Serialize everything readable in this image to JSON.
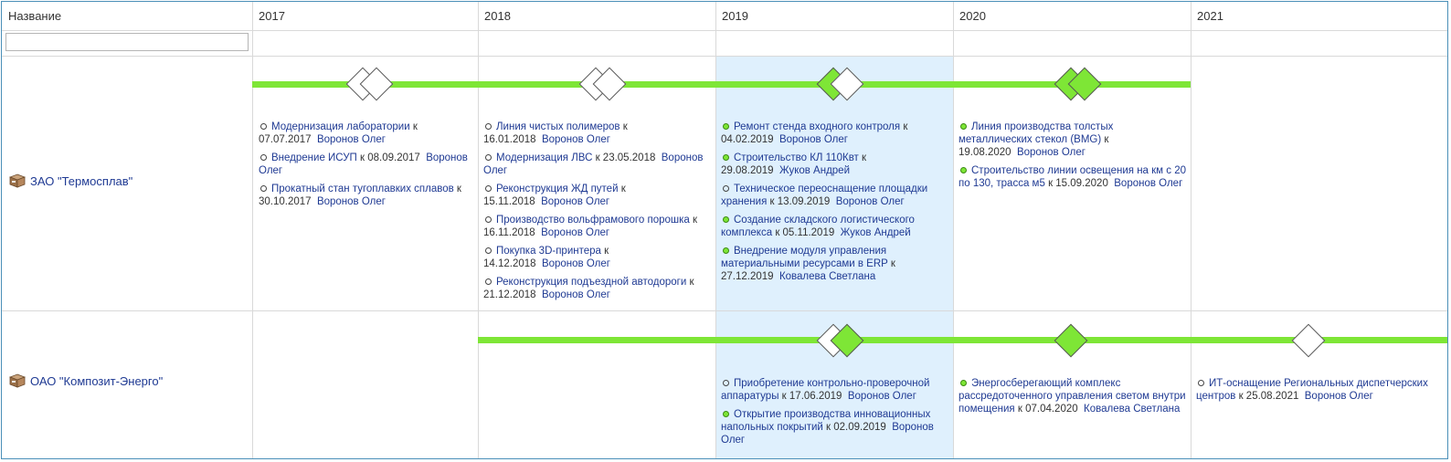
{
  "header": {
    "name_col": "Название",
    "years": [
      "2017",
      "2018",
      "2019",
      "2020",
      "2021"
    ]
  },
  "filter": {
    "value": "",
    "placeholder": ""
  },
  "colors": {
    "done": "#7ee636",
    "highlight": "#dff0fd",
    "link": "#1f3a93"
  },
  "rows": [
    {
      "name": "ЗАО \"Термосплав\"",
      "icon": "package-icon",
      "tasks": {
        "2017": [
          {
            "title": "Модернизация лаборатории",
            "date": "к 07.07.2017",
            "owner": "Воронов Олег",
            "done": false
          },
          {
            "title": "Внедрение ИСУП",
            "date": "к 08.09.2017",
            "owner": "Воронов Олег",
            "done": false
          },
          {
            "title": "Прокатный стан тугоплавких сплавов",
            "date": "к 30.10.2017",
            "owner": "Воронов Олег",
            "done": false
          }
        ],
        "2018": [
          {
            "title": "Линия чистых полимеров",
            "date": "к 16.01.2018",
            "owner": "Воронов Олег",
            "done": false
          },
          {
            "title": "Модернизация ЛВС",
            "date": "к 23.05.2018",
            "owner": "Воронов Олег",
            "done": false
          },
          {
            "title": "Реконструкция ЖД путей",
            "date": "к 15.11.2018",
            "owner": "Воронов Олег",
            "done": false
          },
          {
            "title": "Производство вольфрамового порошка",
            "date": "к 16.11.2018",
            "owner": "Воронов Олег",
            "done": false
          },
          {
            "title": "Покупка 3D-принтера",
            "date": "к 14.12.2018",
            "owner": "Воронов Олег",
            "done": false
          },
          {
            "title": "Реконструкция подъездной автодороги",
            "date": "к 21.12.2018",
            "owner": "Воронов Олег",
            "done": false
          }
        ],
        "2019": [
          {
            "title": "Ремонт стенда входного контроля",
            "date": "к 04.02.2019",
            "owner": "Воронов Олег",
            "done": true
          },
          {
            "title": "Строительство КЛ 110Квт",
            "date": "к 29.08.2019",
            "owner": "Жуков Андрей",
            "done": true
          },
          {
            "title": "Техническое переоснащение площадки хранения",
            "date": "к 13.09.2019",
            "owner": "Воронов Олег",
            "done": false
          },
          {
            "title": "Создание складского логистического комплекса",
            "date": "к 05.11.2019",
            "owner": "Жуков Андрей",
            "done": true
          },
          {
            "title": "Внедрение модуля управления материальными ресурсами в ERP",
            "date": "к 27.12.2019",
            "owner": "Ковалева Светлана",
            "done": true
          }
        ],
        "2020": [
          {
            "title": "Линия производства толстых металлических стекол (BMG)",
            "date": "к 19.08.2020",
            "owner": "Воронов Олег",
            "done": true
          },
          {
            "title": "Строительство линии освещения на км с 20 по 130, трасса м5",
            "date": "к 15.09.2020",
            "owner": "Воронов Олег",
            "done": true
          }
        ],
        "2021": []
      }
    },
    {
      "name": "ОАО \"Композит-Энерго\"",
      "icon": "package-icon",
      "tasks": {
        "2017": [],
        "2018": [],
        "2019": [
          {
            "title": "Приобретение контрольно-проверочной аппаратуры",
            "date": "к 17.06.2019",
            "owner": "Воронов Олег",
            "done": false
          },
          {
            "title": "Открытие производства инновационных напольных покрытий",
            "date": "к 02.09.2019",
            "owner": "Воронов Олег",
            "done": true
          }
        ],
        "2020": [
          {
            "title": "Энергосберегающий комплекс рассредоточенного управления светом внутри помещения",
            "date": "к 07.04.2020",
            "owner": "Ковалева Светлана",
            "done": true
          }
        ],
        "2021": [
          {
            "title": "ИТ-оснащение Региональных диспетчерских центров",
            "date": "к 25.08.2021",
            "owner": "Воронов Олег",
            "done": false
          }
        ]
      }
    }
  ]
}
